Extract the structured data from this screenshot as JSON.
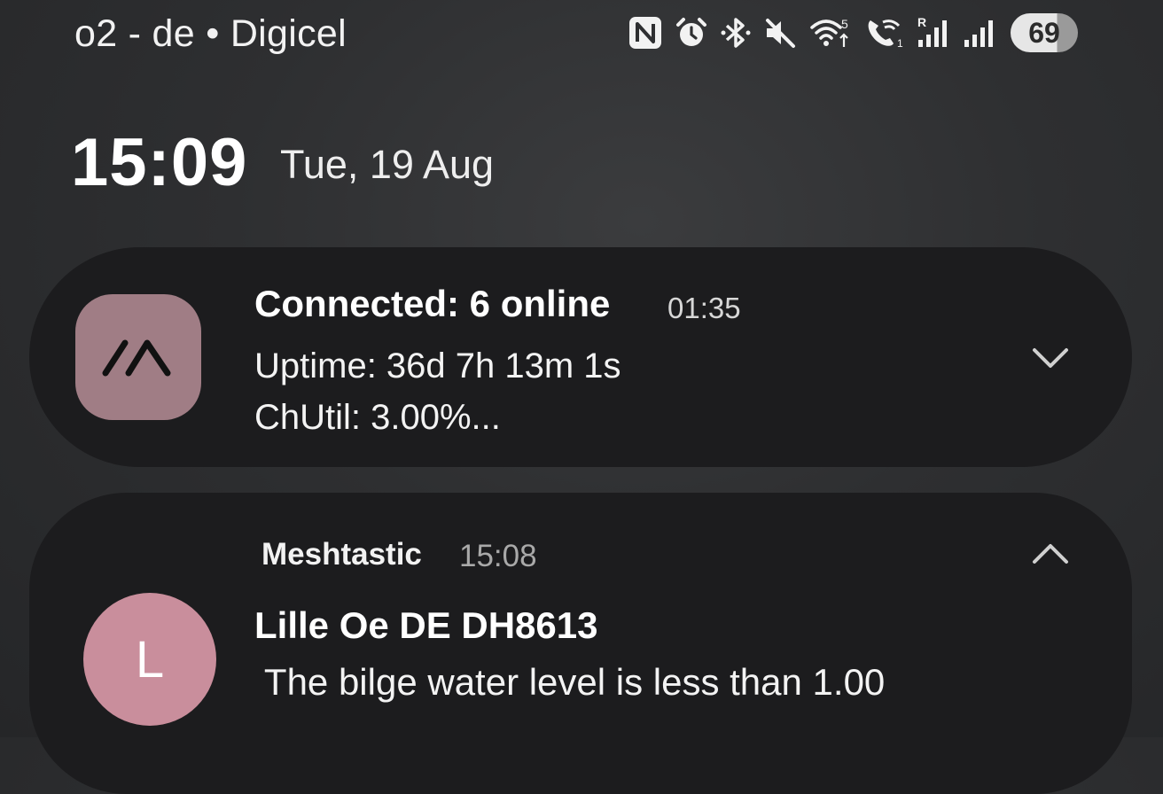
{
  "status_bar": {
    "carrier": "o2 - de • Digicel",
    "icons": [
      "nfc-icon",
      "alarm-icon",
      "bluetooth-icon",
      "mute-icon",
      "wifi-icon",
      "wifi-calling-icon",
      "signal-roaming-icon",
      "signal-icon"
    ],
    "battery_level": "69"
  },
  "lock": {
    "time": "15:09",
    "date": "Tue, 19 Aug"
  },
  "notification_1": {
    "title": "Connected: 6 online",
    "time": "01:35",
    "line1": "Uptime: 36d 7h 13m 1s",
    "line2": "ChUtil: 3.00%...",
    "icon": "meshtastic-logo-icon",
    "icon_bg": "#a07d85"
  },
  "notification_2": {
    "app_name": "Meshtastic",
    "time": "15:08",
    "avatar_letter": "L",
    "avatar_bg": "#c98e9c",
    "sender": "Lille Oe DE DH8613",
    "message": " The bilge water level is less than 1.00"
  }
}
